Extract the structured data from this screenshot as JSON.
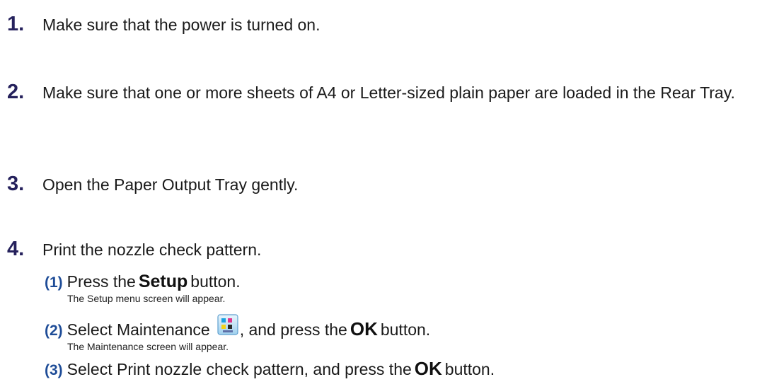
{
  "steps": [
    {
      "num": "1.",
      "text": "Make sure that the power is turned on."
    },
    {
      "num": "2.",
      "text": "Make sure that one or more sheets of A4 or Letter-sized plain paper are loaded in the Rear Tray."
    },
    {
      "num": "3.",
      "text": "Open the Paper Output Tray gently."
    },
    {
      "num": "4.",
      "text": "Print the nozzle check pattern."
    }
  ],
  "substeps": [
    {
      "num": "(1)",
      "before": "Press the",
      "strong": "Setup",
      "after": "button.",
      "note": "The Setup menu screen will appear."
    },
    {
      "num": "(2)",
      "before": "Select Maintenance",
      "icon": "maintenance-icon",
      "mid": ", and press the",
      "strong": "OK",
      "after": "button.",
      "note": "The Maintenance screen will appear."
    },
    {
      "num": "(3)",
      "before": "Select Print nozzle check pattern, and press the",
      "strong": "OK",
      "after": "button."
    }
  ],
  "colors": {
    "step_number": "#25215c",
    "substep_number": "#1e4c97"
  }
}
